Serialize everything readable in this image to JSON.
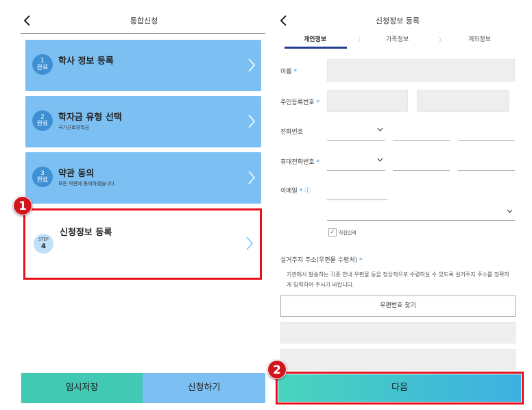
{
  "left": {
    "title": "통합신청",
    "steps": [
      {
        "num": "1",
        "state": "완료",
        "title": "학사 정보 등록",
        "sub": ""
      },
      {
        "num": "2",
        "state": "완료",
        "title": "학자금 유형 선택",
        "sub": "국가근로장학금"
      },
      {
        "num": "3",
        "state": "완료",
        "title": "약관 동의",
        "sub": "모든 약관에 동의하였습니다."
      }
    ],
    "step4": {
      "badge_top": "STEP",
      "num": "4",
      "title": "신청정보 등록"
    },
    "buttons": {
      "temp_save": "임시저장",
      "apply": "신청하기"
    }
  },
  "right": {
    "title": "신청정보 등록",
    "tabs": [
      "개인정보",
      "가족정보",
      "계좌정보"
    ],
    "tab_sep": "〉",
    "fields": {
      "name": "이름",
      "rrn": "주민등록번호",
      "phone": "전화번호",
      "mobile": "휴대전화번호",
      "email": "이메일"
    },
    "required_mark": "*",
    "info_icon": "ⓘ",
    "direct_input": "직접입력",
    "address_label": "실거주지 주소(우편물 수령처)",
    "address_notice": "기관에서 발송하는 각종 안내 우편물 등을 정상적으로 수령하실 수 있도록 실거주지 주소를 정확하게 입력하여 주시기 바랍니다.",
    "zip_button": "우편번호 찾기",
    "next_button": "다음"
  },
  "annotations": {
    "badge1": "1",
    "badge2": "2",
    "highlight_color": "#e8101a"
  }
}
